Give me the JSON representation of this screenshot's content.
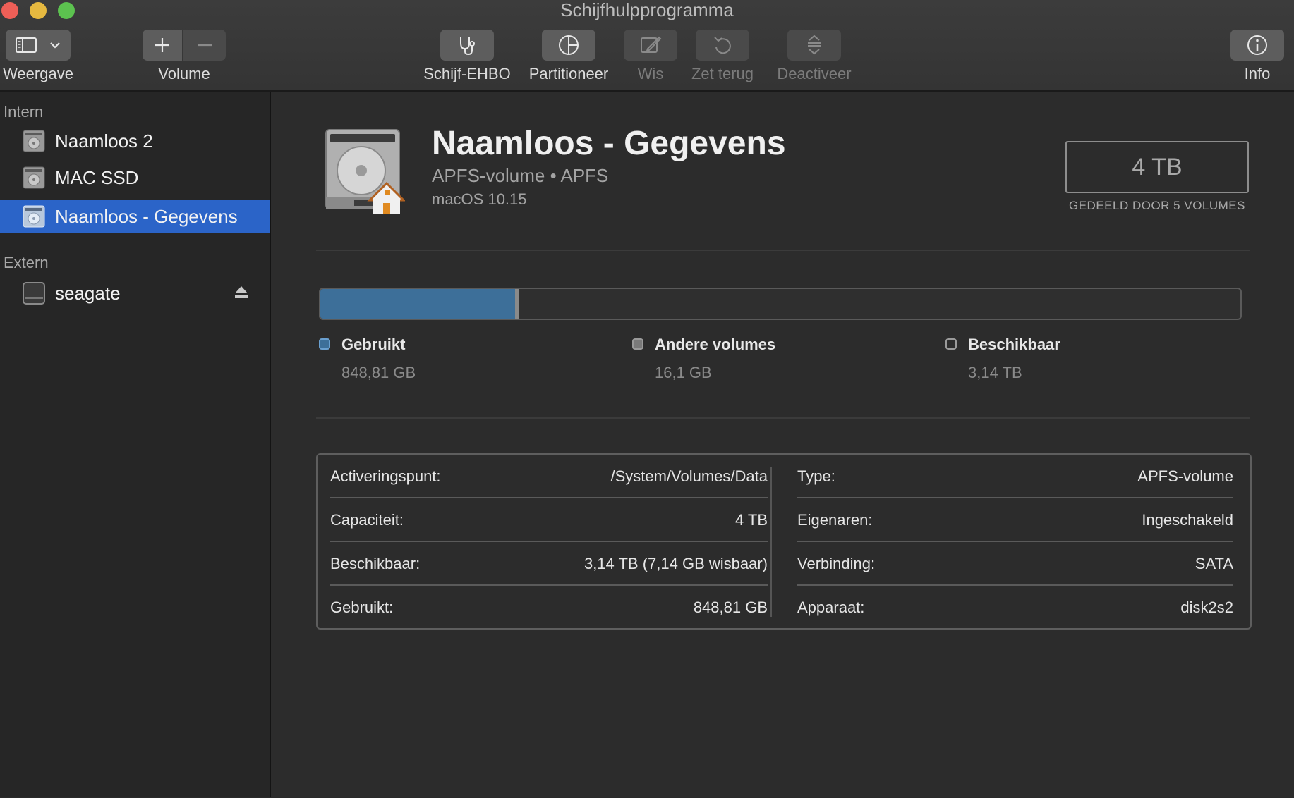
{
  "window": {
    "title": "Schijfhulpprogramma"
  },
  "toolbar": {
    "view_label": "Weergave",
    "volume_label": "Volume",
    "first_aid_label": "Schijf-EHBO",
    "partition_label": "Partitioneer",
    "erase_label": "Wis",
    "restore_label": "Zet terug",
    "unmount_label": "Deactiveer",
    "info_label": "Info"
  },
  "sidebar": {
    "internal_header": "Intern",
    "external_header": "Extern",
    "internal_items": [
      {
        "label": "Naamloos 2",
        "selected": false
      },
      {
        "label": "MAC SSD",
        "selected": false
      },
      {
        "label": "Naamloos - Gegevens",
        "selected": true
      }
    ],
    "external_items": [
      {
        "label": "seagate",
        "ejectable": true
      }
    ]
  },
  "volume": {
    "name": "Naamloos - Gegevens",
    "subtitle": "APFS-volume • APFS",
    "os": "macOS 10.15",
    "capacity": "4 TB",
    "capacity_caption": "GEDEELD DOOR 5 VOLUMES"
  },
  "usage": {
    "used_fraction": 0.212,
    "other_fraction": 0.004,
    "colors": {
      "used": "#3d6f99",
      "other": "#8a8a8a",
      "free": "#2f2f2f",
      "accent": "#2b64c8"
    },
    "legend": [
      {
        "label": "Gebruikt",
        "value": "848,81 GB"
      },
      {
        "label": "Andere volumes",
        "value": "16,1 GB"
      },
      {
        "label": "Beschikbaar",
        "value": "3,14 TB"
      }
    ]
  },
  "info": {
    "left": [
      {
        "key": "Activeringspunt:",
        "value": "/System/Volumes/Data"
      },
      {
        "key": "Capaciteit:",
        "value": "4 TB"
      },
      {
        "key": "Beschikbaar:",
        "value": "3,14 TB (7,14 GB wisbaar)"
      },
      {
        "key": "Gebruikt:",
        "value": "848,81 GB"
      }
    ],
    "right": [
      {
        "key": "Type:",
        "value": "APFS-volume"
      },
      {
        "key": "Eigenaren:",
        "value": "Ingeschakeld"
      },
      {
        "key": "Verbinding:",
        "value": "SATA"
      },
      {
        "key": "Apparaat:",
        "value": "disk2s2"
      }
    ]
  }
}
